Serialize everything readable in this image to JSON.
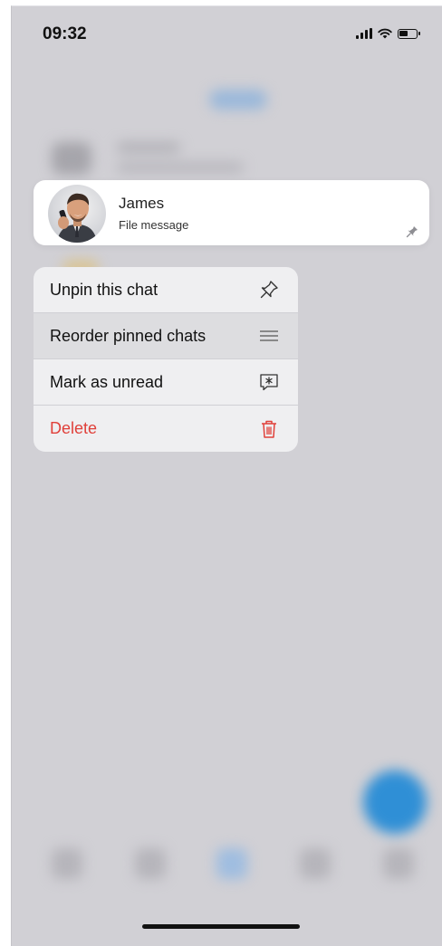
{
  "status_bar": {
    "time": "09:32"
  },
  "pinned_chat": {
    "name": "James",
    "preview": "File message",
    "pinned": true
  },
  "context_menu": {
    "items": [
      {
        "label": "Unpin this chat",
        "icon": "pin-icon"
      },
      {
        "label": "Reorder pinned chats",
        "icon": "drag-handle-icon"
      },
      {
        "label": "Mark as unread",
        "icon": "unread-message-icon"
      },
      {
        "label": "Delete",
        "icon": "trash-icon"
      }
    ]
  },
  "colors": {
    "danger": "#e0403a",
    "accent": "#2f8fd6",
    "overlay": "#d1d0d5"
  }
}
